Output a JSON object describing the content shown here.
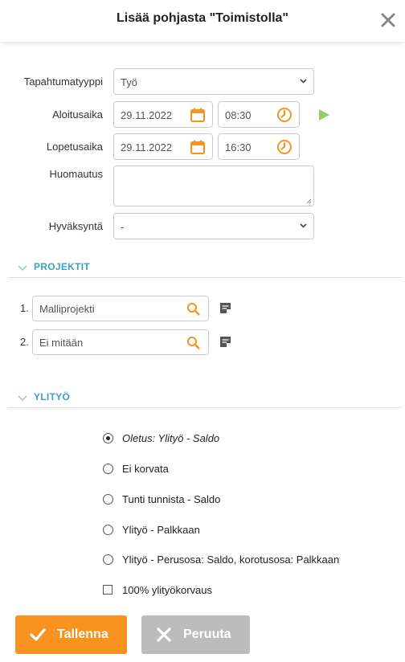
{
  "header": {
    "title": "Lisää pohjasta \"Toimistolla\""
  },
  "form": {
    "event_type": {
      "label": "Tapahtumatyyppi",
      "value": "Työ"
    },
    "start": {
      "label": "Aloitusaika",
      "date": "29.11.2022",
      "time": "08:30"
    },
    "end": {
      "label": "Lopetusaika",
      "date": "29.11.2022",
      "time": "16:30"
    },
    "note": {
      "label": "Huomautus",
      "value": ""
    },
    "approval": {
      "label": "Hyväksyntä",
      "value": "-"
    }
  },
  "projects": {
    "title": "PROJEKTIT",
    "items": [
      {
        "num": "1.",
        "value": "Malliprojekti"
      },
      {
        "num": "2.",
        "value": "Ei mitään"
      }
    ]
  },
  "overtime": {
    "title": "YLITYÖ",
    "options": [
      {
        "label": "Oletus: Ylityö - Saldo",
        "selected": true
      },
      {
        "label": "Ei korvata",
        "selected": false
      },
      {
        "label": "Tunti tunnista - Saldo",
        "selected": false
      },
      {
        "label": "Ylityö - Palkkaan",
        "selected": false
      },
      {
        "label": "Ylityö - Perusosa: Saldo, korotusosa: Palkkaan",
        "selected": false
      }
    ],
    "checkbox_label": "100% ylityökorvaus",
    "checkbox_checked": false
  },
  "buttons": {
    "save": "Tallenna",
    "cancel": "Peruuta"
  },
  "colors": {
    "accent_orange": "#f7931e",
    "link_blue": "#3aa0c8",
    "play_green": "#8fd16a",
    "cancel_gray": "#bcbcbc"
  }
}
